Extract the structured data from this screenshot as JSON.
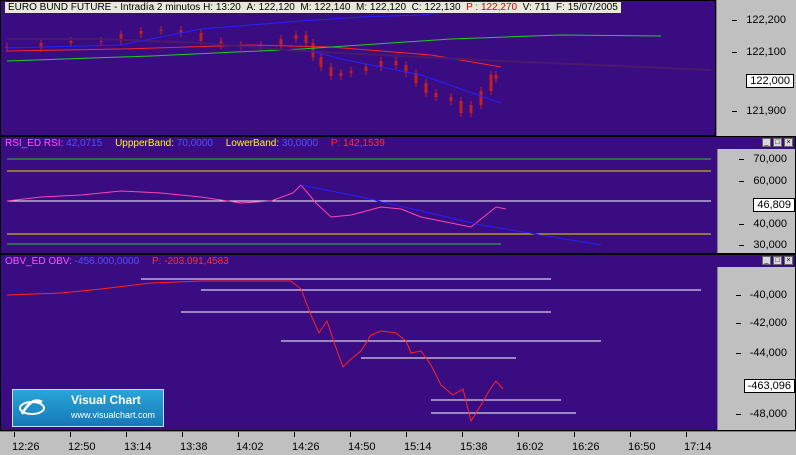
{
  "main": {
    "instrument": "EURO BUND FUTURE",
    "interval": "Intradía 2 minutos",
    "h_label": "H:",
    "h_value": "13:20",
    "a_label": "A:",
    "a_value": "122,120",
    "m_label": "M:",
    "m_value": "122,140",
    "mn_label": "M:",
    "mn_value": "122,120",
    "c_label": "C:",
    "c_value": "122,130",
    "p_label": "P :",
    "p_value": "122,270",
    "v_label": "V:",
    "v_value": "711",
    "f_label": "F:",
    "f_value": "15/07/2005",
    "axis": [
      "122,200",
      "122,100",
      "121,900"
    ],
    "last_value": "122,000"
  },
  "rsi": {
    "name": "RSI_ED",
    "label": "RSI:",
    "value": "42,0715",
    "upper_label": "UppperBand:",
    "upper_value": "70,0000",
    "lower_label": "LowerBand:",
    "lower_value": "30,0000",
    "p_label": "P:",
    "p_value": "142,1539",
    "axis": [
      "70,000",
      "60,000",
      "40,000",
      "30,000"
    ],
    "last_value": "46,809"
  },
  "obv": {
    "name": "OBV_ED",
    "label": "OBV:",
    "value": "-456.000,0000",
    "p_label": "P:",
    "p_value": "-203.091,4583",
    "axis": [
      "-40,000",
      "-42,000",
      "-44,000",
      "-48,000"
    ],
    "last_value": "-463,096"
  },
  "time_axis": [
    "12:26",
    "12:50",
    "13:14",
    "13:38",
    "14:02",
    "14:26",
    "14:50",
    "15:14",
    "15:38",
    "16:02",
    "16:26",
    "16:50",
    "17:14"
  ],
  "window_buttons": [
    "_",
    "□",
    "×"
  ],
  "logo": {
    "name": "Visual Chart",
    "url": "www.visualchart.com"
  },
  "colors": {
    "background": "#3a0c82",
    "candle": "#c02020",
    "price_series": "#ff2222",
    "rsi_line": "#ff44aa",
    "obv_line": "#ff2222",
    "ma_fast": "#2222ff",
    "ma_slow": "#22cc22",
    "trend": "#4a1a6a",
    "band": "#e0e000"
  }
}
